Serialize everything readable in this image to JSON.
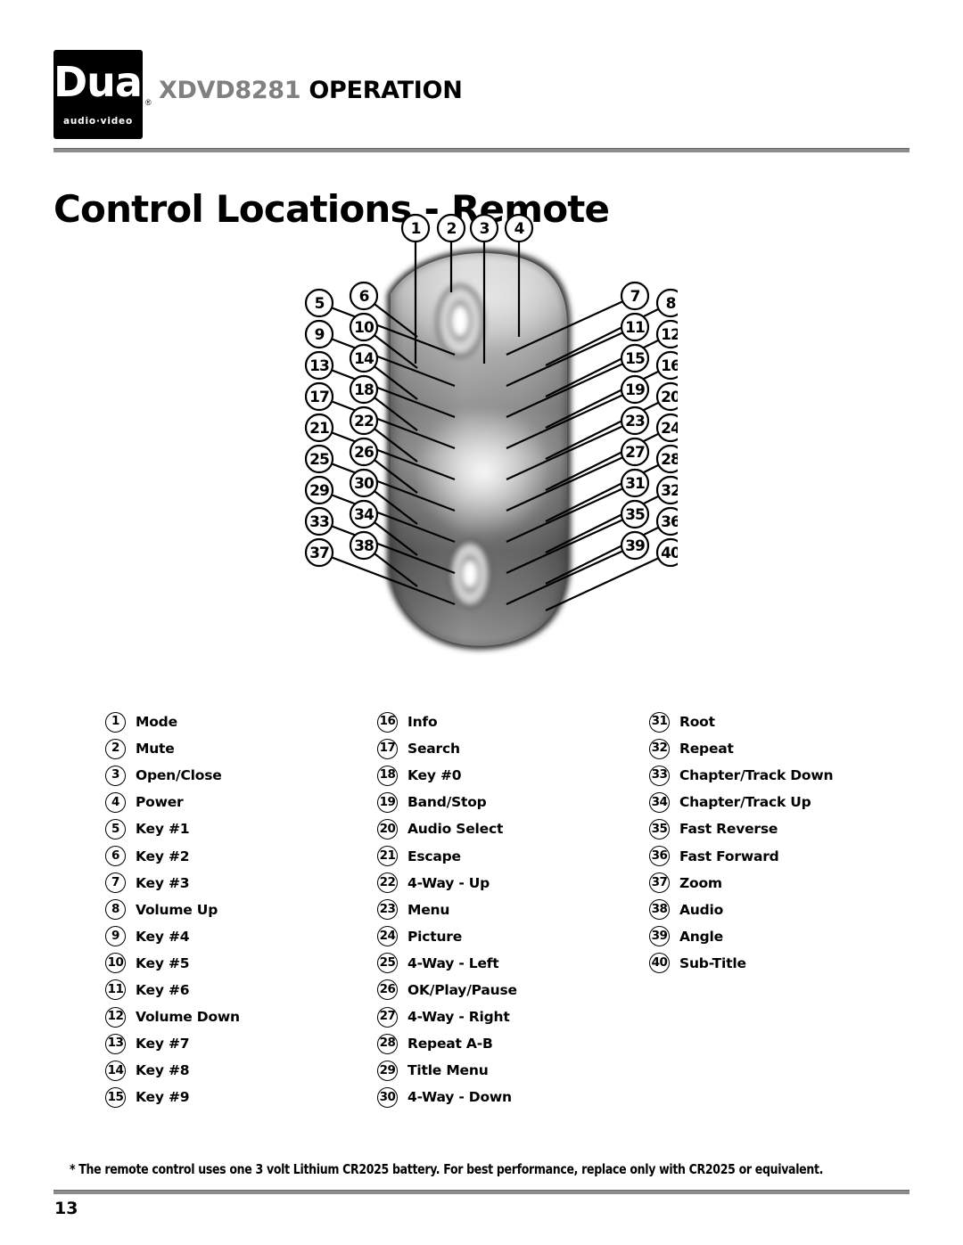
{
  "header": {
    "logo_word": "Dual",
    "logo_sub": "audio·video",
    "logo_reg": "®",
    "model": "XDVD8281",
    "section": "OPERATION"
  },
  "page_title": "Control Locations - Remote",
  "diagram": {
    "name": "remote-control-diagram",
    "callouts_top": [
      1,
      2,
      3,
      4
    ],
    "callouts_left_inner": [
      6,
      10,
      14,
      18,
      22,
      26,
      30,
      34,
      38
    ],
    "callouts_left_outer": [
      5,
      9,
      13,
      17,
      21,
      25,
      29,
      33,
      37
    ],
    "callouts_right_inner": [
      7,
      11,
      15,
      19,
      23,
      27,
      31,
      35,
      39
    ],
    "callouts_right_outer": [
      8,
      12,
      16,
      20,
      24,
      28,
      32,
      36,
      40
    ]
  },
  "legend": {
    "columns": [
      [
        {
          "num": "1",
          "label": "Mode"
        },
        {
          "num": "2",
          "label": "Mute"
        },
        {
          "num": "3",
          "label": "Open/Close"
        },
        {
          "num": "4",
          "label": "Power"
        },
        {
          "num": "5",
          "label": "Key #1"
        },
        {
          "num": "6",
          "label": "Key #2"
        },
        {
          "num": "7",
          "label": "Key #3"
        },
        {
          "num": "8",
          "label": "Volume Up"
        },
        {
          "num": "9",
          "label": "Key #4"
        },
        {
          "num": "10",
          "label": "Key #5"
        },
        {
          "num": "11",
          "label": "Key #6"
        },
        {
          "num": "12",
          "label": "Volume Down"
        },
        {
          "num": "13",
          "label": "Key #7"
        },
        {
          "num": "14",
          "label": "Key #8"
        },
        {
          "num": "15",
          "label": "Key #9"
        }
      ],
      [
        {
          "num": "16",
          "label": "Info"
        },
        {
          "num": "17",
          "label": "Search"
        },
        {
          "num": "18",
          "label": "Key #0"
        },
        {
          "num": "19",
          "label": "Band/Stop"
        },
        {
          "num": "20",
          "label": "Audio Select"
        },
        {
          "num": "21",
          "label": "Escape"
        },
        {
          "num": "22",
          "label": "4-Way - Up"
        },
        {
          "num": "23",
          "label": "Menu"
        },
        {
          "num": "24",
          "label": "Picture"
        },
        {
          "num": "25",
          "label": "4-Way - Left"
        },
        {
          "num": "26",
          "label": "OK/Play/Pause"
        },
        {
          "num": "27",
          "label": "4-Way - Right"
        },
        {
          "num": "28",
          "label": "Repeat A-B"
        },
        {
          "num": "29",
          "label": "Title Menu"
        },
        {
          "num": "30",
          "label": "4-Way - Down"
        }
      ],
      [
        {
          "num": "31",
          "label": "Root"
        },
        {
          "num": "32",
          "label": "Repeat"
        },
        {
          "num": "33",
          "label": "Chapter/Track Down"
        },
        {
          "num": "34",
          "label": "Chapter/Track Up"
        },
        {
          "num": "35",
          "label": "Fast Reverse"
        },
        {
          "num": "36",
          "label": "Fast Forward"
        },
        {
          "num": "37",
          "label": "Zoom"
        },
        {
          "num": "38",
          "label": "Audio"
        },
        {
          "num": "39",
          "label": "Angle"
        },
        {
          "num": "40",
          "label": "Sub-Title"
        }
      ]
    ]
  },
  "footnote": "* The remote control uses one 3 volt Lithium CR2025 battery. For best performance, replace only with CR2025 or equivalent.",
  "page_number": "13",
  "colors": {
    "rule_gray": "#8c8c8c",
    "model_gray": "#808080",
    "ink": "#000000",
    "paper": "#ffffff"
  }
}
